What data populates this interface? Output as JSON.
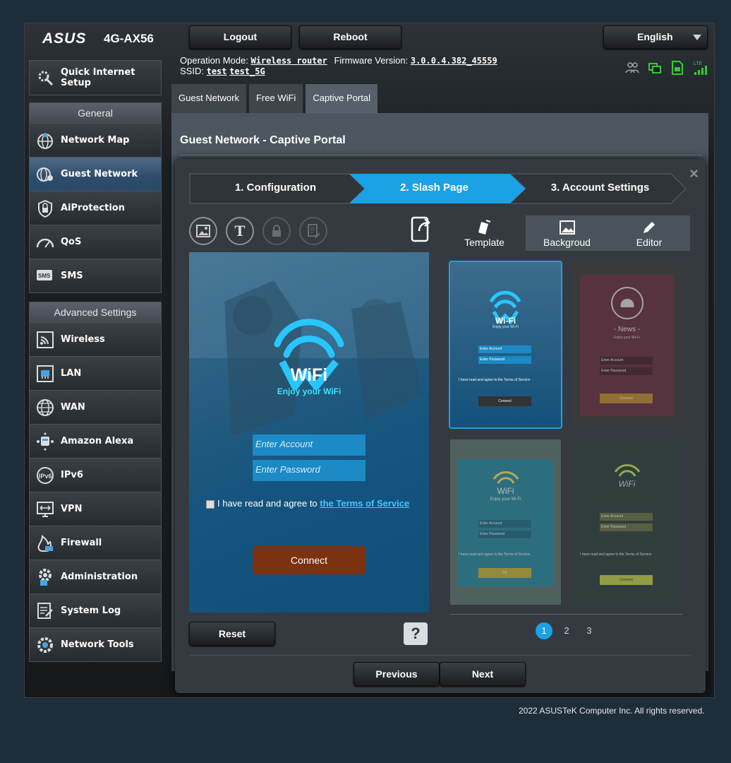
{
  "header": {
    "brand": "ASUS",
    "model": "4G-AX56",
    "logout": "Logout",
    "reboot": "Reboot",
    "language": "English"
  },
  "status": {
    "op_mode_label": "Operation Mode:",
    "op_mode": "Wireless router",
    "firmware_label": "Firmware Version:",
    "firmware": "3.0.0.4.382_45559",
    "ssid_label": "SSID:",
    "ssid1": "test",
    "ssid2": "test_5G",
    "lte_label": "LTE"
  },
  "sidebar": {
    "quick_setup": "Quick Internet Setup",
    "general_label": "General",
    "general": [
      {
        "label": "Network Map",
        "icon": "network-map-icon"
      },
      {
        "label": "Guest Network",
        "icon": "guest-network-icon"
      },
      {
        "label": "AiProtection",
        "icon": "aiprotection-icon"
      },
      {
        "label": "QoS",
        "icon": "qos-icon"
      },
      {
        "label": "SMS",
        "icon": "sms-icon"
      }
    ],
    "advanced_label": "Advanced Settings",
    "advanced": [
      {
        "label": "Wireless",
        "icon": "wireless-icon"
      },
      {
        "label": "LAN",
        "icon": "lan-icon"
      },
      {
        "label": "WAN",
        "icon": "wan-icon"
      },
      {
        "label": "Amazon Alexa",
        "icon": "alexa-icon"
      },
      {
        "label": "IPv6",
        "icon": "ipv6-icon"
      },
      {
        "label": "VPN",
        "icon": "vpn-icon"
      },
      {
        "label": "Firewall",
        "icon": "firewall-icon"
      },
      {
        "label": "Administration",
        "icon": "administration-icon"
      },
      {
        "label": "System Log",
        "icon": "system-log-icon"
      },
      {
        "label": "Network Tools",
        "icon": "network-tools-icon"
      }
    ],
    "sms_badge": "SMS",
    "ipv6_badge": "IPv6"
  },
  "tabs": [
    "Guest Network",
    "Free WiFi",
    "Captive Portal"
  ],
  "page_title": "Guest Network - Captive Portal",
  "wizard": {
    "steps": [
      "1. Configuration",
      "2. Slash Page",
      "3. Account Settings"
    ],
    "active_step": 2,
    "close": "×"
  },
  "preview": {
    "wifi": "WiFi",
    "enjoy": "Enjoy your WiFi",
    "account_placeholder": "Enter Account",
    "password_placeholder": "Enter Password",
    "tos_text": "I have read and agree to ",
    "tos_link": "the Terms of Service",
    "connect": "Connect"
  },
  "panel": {
    "tabs": [
      {
        "label": "Template",
        "icon": "template-icon"
      },
      {
        "label": "Backgroud",
        "icon": "image-icon"
      },
      {
        "label": "Editor",
        "icon": "pencil-icon"
      }
    ],
    "thumb1": {
      "title": "Wi-Fi",
      "sub": "Enjoy your Wi-Fi",
      "acc": "Enter Account",
      "pwd": "Enter Password",
      "tos": "I have read and agree to the Terms of Service",
      "btn": "Connect"
    },
    "thumb2": {
      "title": "- News -",
      "sub": "Enjoy your Wi-Fi",
      "acc": "Enter Account",
      "pwd": "Enter Password",
      "btn": "Connect"
    },
    "thumb3": {
      "title": "WiFi",
      "sub": "Enjoy your Wi-Fi",
      "acc": "Enter Account",
      "pwd": "Enter Password",
      "tos": "I have read and agree to the Terms of Service",
      "btn": "OK"
    },
    "thumb4": {
      "title": "WiFi",
      "acc": "Enter Account",
      "pwd": "Enter Password",
      "tos": "I have read and agree to the Terms of Service",
      "btn": "Connect"
    },
    "pages": [
      "1",
      "2",
      "3"
    ]
  },
  "buttons": {
    "reset": "Reset",
    "help": "?",
    "previous": "Previous",
    "next": "Next"
  },
  "footer": "2022 ASUSTeK Computer Inc. All rights reserved."
}
